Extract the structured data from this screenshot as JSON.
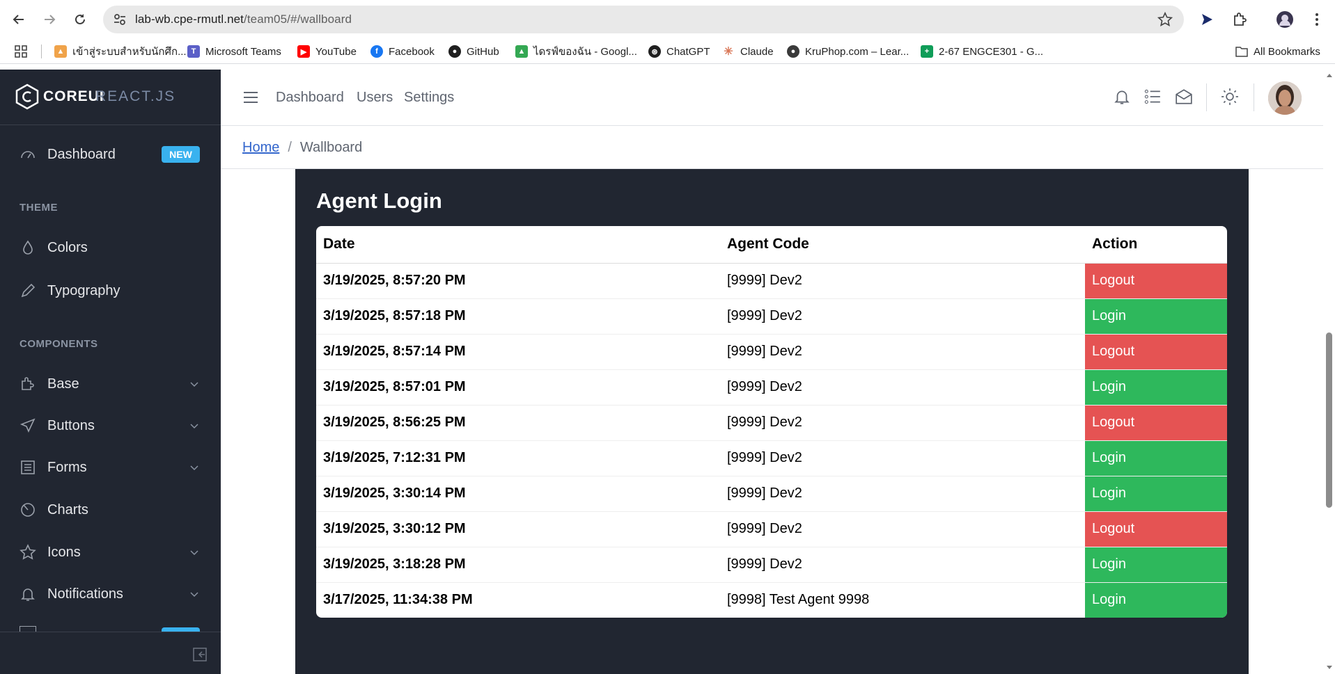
{
  "browser": {
    "url_host": "lab-wb.cpe-rmutl.net",
    "url_path": "/team05/#/wallboard",
    "bookmarks": [
      {
        "label": "เข้าสู่ระบบสำหรับนักศึก...",
        "icon": "temple-icon"
      },
      {
        "label": "Microsoft Teams",
        "icon": "teams-icon"
      },
      {
        "label": "YouTube",
        "icon": "youtube-icon"
      },
      {
        "label": "Facebook",
        "icon": "facebook-icon"
      },
      {
        "label": "GitHub",
        "icon": "github-icon"
      },
      {
        "label": "ไดรฟ์ของฉัน - Googl...",
        "icon": "drive-icon"
      },
      {
        "label": "ChatGPT",
        "icon": "chatgpt-icon"
      },
      {
        "label": "Claude",
        "icon": "claude-icon"
      },
      {
        "label": "KruPhop.com – Lear...",
        "icon": "kruphop-icon"
      },
      {
        "label": "2-67 ENGCE301 - G...",
        "icon": "sheets-icon"
      }
    ],
    "all_bookmarks": "All Bookmarks"
  },
  "sidebar": {
    "brand_core": "COREUI",
    "brand_react": "REACT.JS",
    "dashboard": "Dashboard",
    "dashboard_badge": "NEW",
    "theme_title": "THEME",
    "colors": "Colors",
    "typography": "Typography",
    "components_title": "COMPONENTS",
    "base": "Base",
    "buttons": "Buttons",
    "forms": "Forms",
    "charts": "Charts",
    "icons": "Icons",
    "notifications": "Notifications"
  },
  "header": {
    "nav": [
      "Dashboard",
      "Users",
      "Settings"
    ]
  },
  "breadcrumb": {
    "home": "Home",
    "current": "Wallboard"
  },
  "main": {
    "title": "Agent Login",
    "columns": [
      "Date",
      "Agent Code",
      "Action"
    ],
    "rows": [
      {
        "date": "3/19/2025, 8:57:20 PM",
        "agent": "[9999] Dev2",
        "action": "Logout"
      },
      {
        "date": "3/19/2025, 8:57:18 PM",
        "agent": "[9999] Dev2",
        "action": "Login"
      },
      {
        "date": "3/19/2025, 8:57:14 PM",
        "agent": "[9999] Dev2",
        "action": "Logout"
      },
      {
        "date": "3/19/2025, 8:57:01 PM",
        "agent": "[9999] Dev2",
        "action": "Login"
      },
      {
        "date": "3/19/2025, 8:56:25 PM",
        "agent": "[9999] Dev2",
        "action": "Logout"
      },
      {
        "date": "3/19/2025, 7:12:31 PM",
        "agent": "[9999] Dev2",
        "action": "Login"
      },
      {
        "date": "3/19/2025, 3:30:14 PM",
        "agent": "[9999] Dev2",
        "action": "Login"
      },
      {
        "date": "3/19/2025, 3:30:12 PM",
        "agent": "[9999] Dev2",
        "action": "Logout"
      },
      {
        "date": "3/19/2025, 3:18:28 PM",
        "agent": "[9999] Dev2",
        "action": "Login"
      },
      {
        "date": "3/17/2025, 11:34:38 PM",
        "agent": "[9998] Test Agent 9998",
        "action": "Login"
      }
    ]
  },
  "colors": {
    "sidebar_bg": "#212631",
    "logout": "#e55353",
    "login": "#2eb85c",
    "badge": "#39b2ef",
    "link": "#3366cc"
  }
}
